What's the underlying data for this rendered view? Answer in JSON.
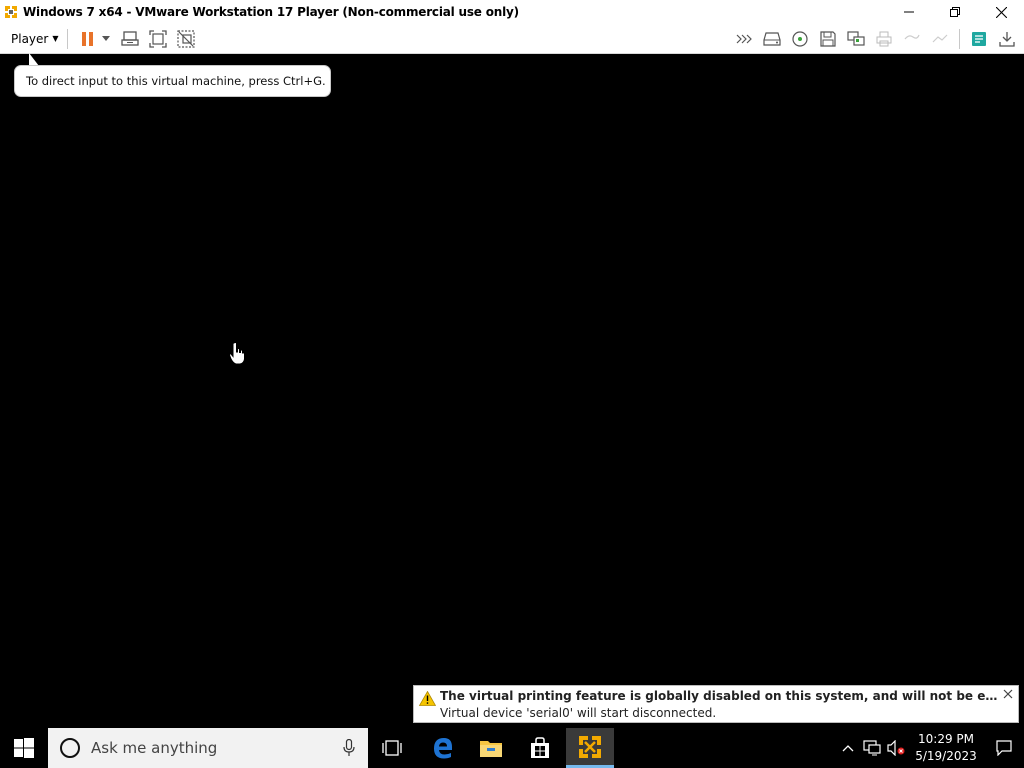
{
  "window": {
    "title": "Windows 7 x64 - VMware Workstation 17 Player (Non-commercial use only)",
    "controls": {
      "minimize": "─",
      "restore": "❐",
      "close": "✕"
    }
  },
  "toolbar": {
    "player_label": "Player",
    "left_icons": [
      "pause-icon",
      "dropdown-icon",
      "send-ctrl-alt-del-icon",
      "fullscreen-icon",
      "unity-icon"
    ],
    "right_icons": [
      "more-devices-icon",
      "hard-disk-icon",
      "cd-dvd-icon",
      "floppy-icon",
      "network-adapter-icon",
      "printer-icon",
      "sound-icon",
      "usb-icon",
      "message-log-icon",
      "download-icon"
    ]
  },
  "tooltip": {
    "text": "To direct input to this virtual machine, press Ctrl+G."
  },
  "notification": {
    "line1": "The virtual printing feature is globally disabled on this system, and will not be enabled for this virtual machine.",
    "line2": "Virtual device 'serial0' will start disconnected.",
    "close_label": "✕"
  },
  "taskbar": {
    "search_placeholder": "Ask me anything",
    "apps": [
      "task-view-icon",
      "edge-icon",
      "file-explorer-icon",
      "store-icon",
      "vmware-icon"
    ],
    "clock_time": "10:29 PM",
    "clock_date": "5/19/2023"
  },
  "colors": {
    "vm_screen": "#000000",
    "pause_orange": "#e8732a",
    "vmware_yellow": "#f2a900",
    "edge_blue": "#1e73d2",
    "explorer_yellow": "#f5c542",
    "taskbar_active_underline": "#76b9ed",
    "warning_yellow": "#f5c400"
  }
}
